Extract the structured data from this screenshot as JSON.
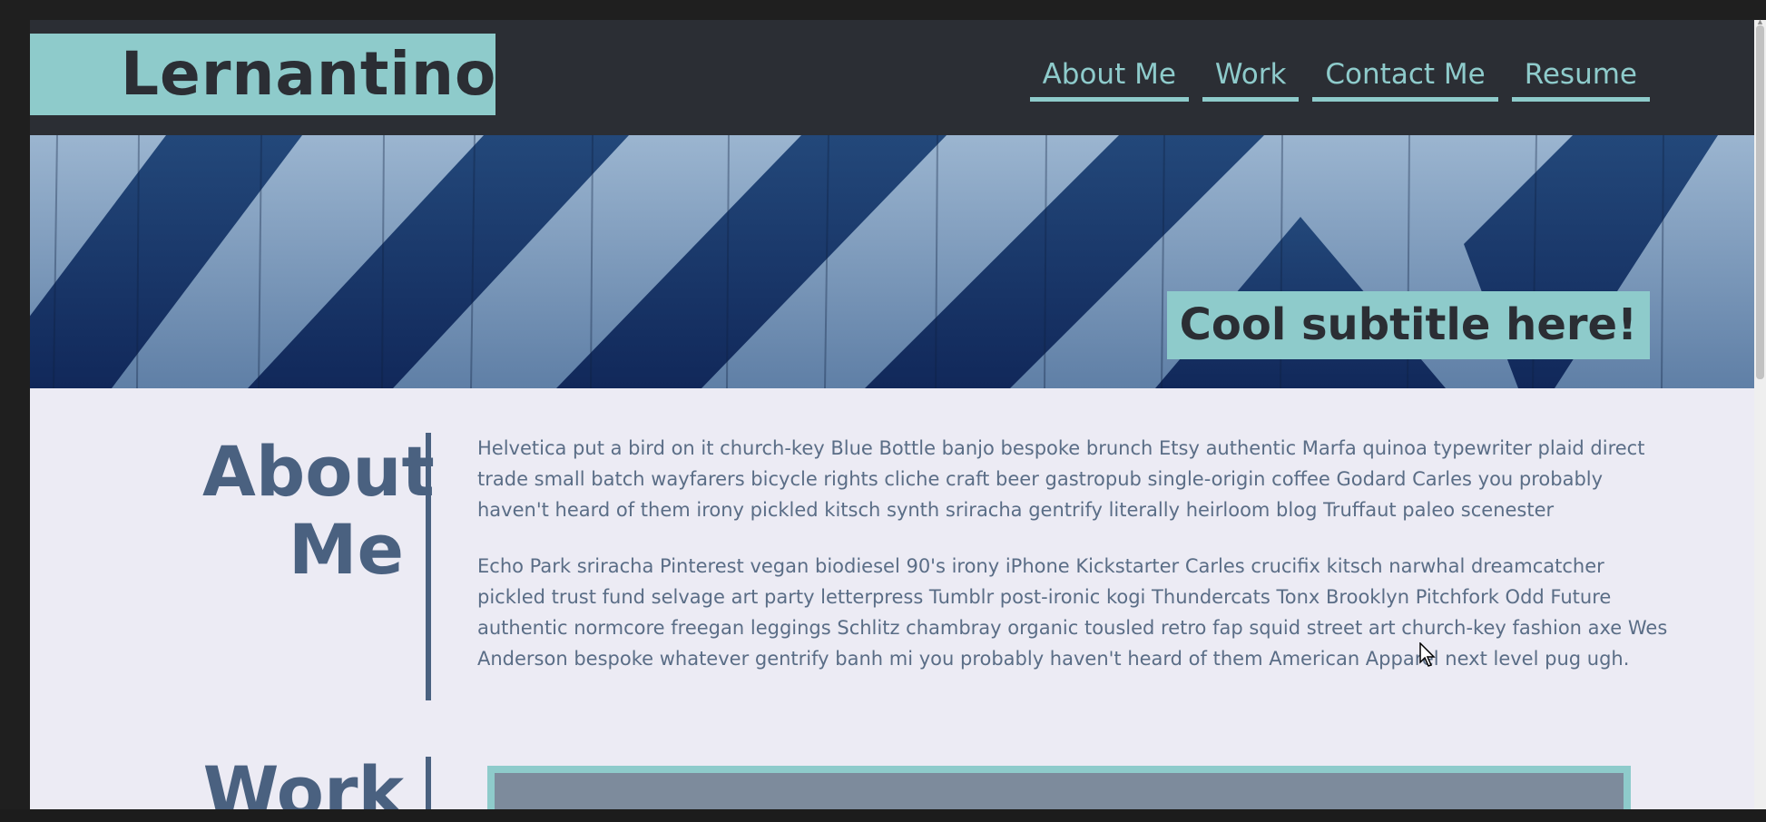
{
  "header": {
    "logo": "Lernantino",
    "nav": [
      "About Me",
      "Work",
      "Contact Me",
      "Resume"
    ]
  },
  "hero": {
    "subtitle": "Cool subtitle here!"
  },
  "about": {
    "title_line1": "About",
    "title_line2": "Me",
    "paragraphs": [
      "Helvetica put a bird on it church-key Blue Bottle banjo bespoke brunch Etsy authentic Marfa quinoa typewriter plaid direct trade small batch wayfarers bicycle rights cliche craft beer gastropub single-origin coffee Godard Carles you probably haven't heard of them irony pickled kitsch synth sriracha gentrify literally heirloom blog Truffaut paleo scenester",
      "Echo Park sriracha Pinterest vegan biodiesel 90's irony iPhone Kickstarter Carles crucifix kitsch narwhal dreamcatcher pickled trust fund selvage art party letterpress Tumblr post-ironic kogi Thundercats Tonx Brooklyn Pitchfork Odd Future authentic normcore freegan leggings Schlitz chambray organic tousled retro fap squid street art church-key fashion axe Wes Anderson bespoke whatever gentrify banh mi you probably haven't heard of them American Apparel next level pug ugh."
    ]
  },
  "work": {
    "title": "Work"
  },
  "colors": {
    "header_bg": "#2b2e34",
    "accent": "#8ecbcb",
    "page_bg": "#ecebf4",
    "heading": "#4a6180",
    "body_text": "#5a6d86"
  }
}
